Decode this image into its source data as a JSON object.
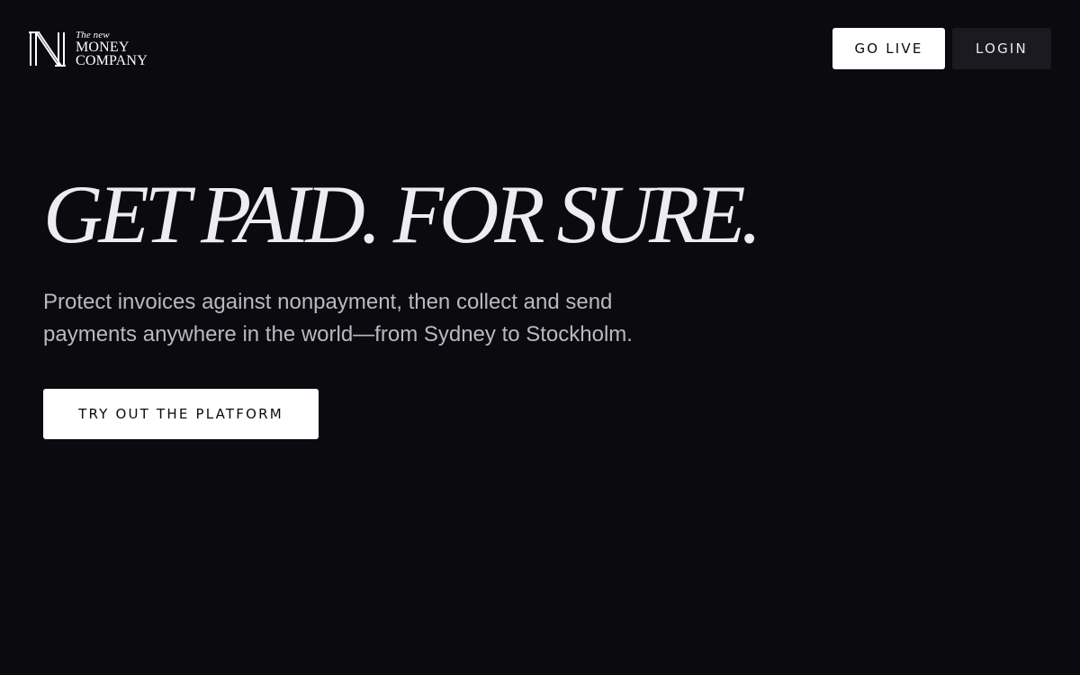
{
  "brand": {
    "logo_icon": "n-monogram-icon",
    "tagline": "The new",
    "name_line1": "MONEY",
    "name_line2": "COMPANY"
  },
  "header": {
    "go_live_label": "GO LIVE",
    "login_label": "LOGIN"
  },
  "hero": {
    "title": "GET PAID. FOR SURE.",
    "subtitle": "Protect invoices against nonpayment, then collect and send payments anywhere in the world—from Sydney to Stockholm.",
    "cta_label": "TRY OUT THE PLATFORM"
  },
  "colors": {
    "background": "#0b0a0f",
    "primary_button": "#ffffff",
    "secondary_button": "#1b1a20",
    "title_text": "#ececf2",
    "subtitle_text": "#b9b9c2"
  }
}
